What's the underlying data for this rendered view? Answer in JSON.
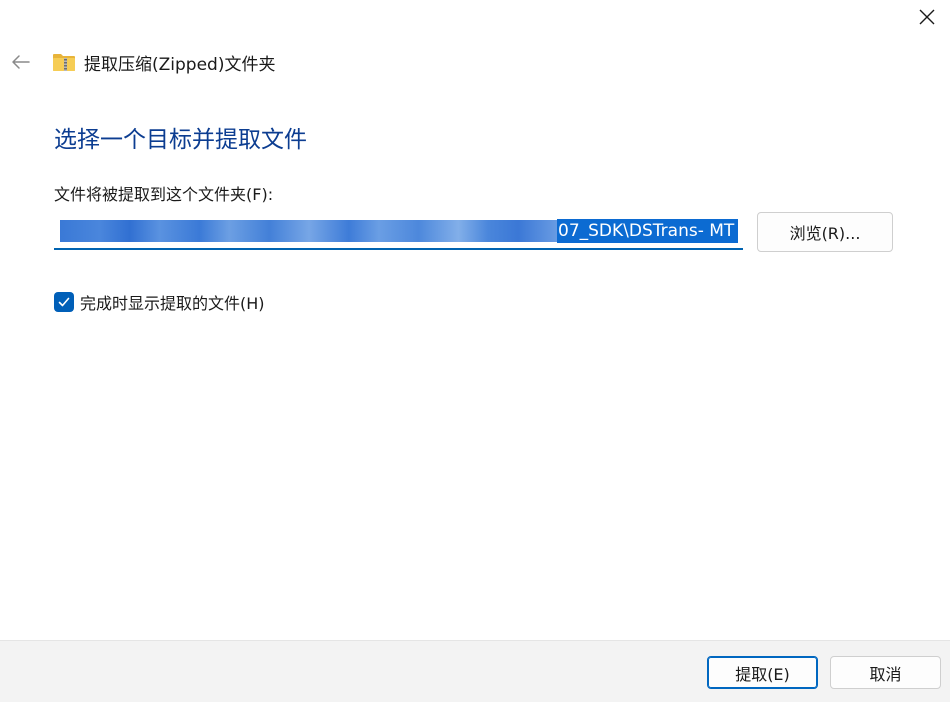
{
  "window": {
    "title": "提取压缩(Zipped)文件夹",
    "close_icon": "close-icon",
    "back_icon": "back-arrow-icon",
    "folder_icon": "zipped-folder-icon"
  },
  "main": {
    "heading": "选择一个目标并提取文件",
    "destination_label": "文件将被提取到这个文件夹(F):",
    "destination_value_visible": "07_SDK\\DSTrans- MT",
    "browse_label": "浏览(R)...",
    "show_files_label": "完成时显示提取的文件(H)",
    "show_files_checked": true
  },
  "footer": {
    "extract_label": "提取(E)",
    "cancel_label": "取消"
  },
  "colors": {
    "heading": "#0c3d91",
    "accent": "#005fb8",
    "selection": "#0c6bd2",
    "footer_bg": "#f3f3f3"
  }
}
